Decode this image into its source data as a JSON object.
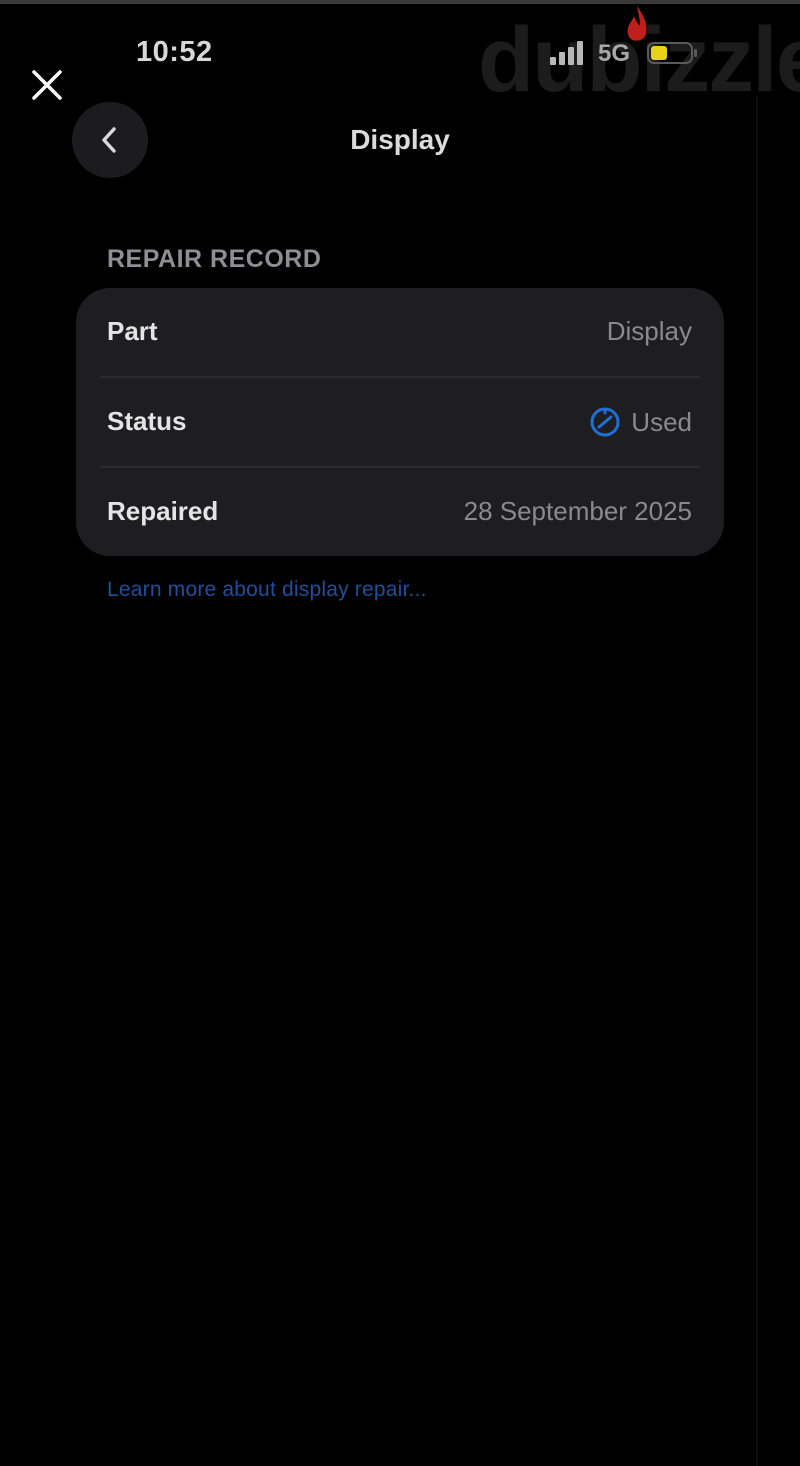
{
  "status_bar": {
    "time": "10:52",
    "network": "5G",
    "signal_icon": "cellular-signal-icon",
    "battery_icon": "battery-icon"
  },
  "overlay": {
    "close_icon": "close-icon",
    "watermark_text": "dubizzle"
  },
  "nav": {
    "back_icon": "chevron-left-icon",
    "title": "Display"
  },
  "repair_record": {
    "header": "REPAIR RECORD",
    "rows": [
      {
        "label": "Part",
        "value": "Display"
      },
      {
        "label": "Status",
        "value": "Used",
        "icon": "used-status-icon"
      },
      {
        "label": "Repaired",
        "value": "28 September 2025"
      }
    ],
    "link": "Learn more about display repair..."
  },
  "colors": {
    "background": "#000000",
    "card": "#1e1e20",
    "accent_blue": "#1f6fd6",
    "link": "#1f4f9a",
    "battery_low": "#e6d21a"
  }
}
